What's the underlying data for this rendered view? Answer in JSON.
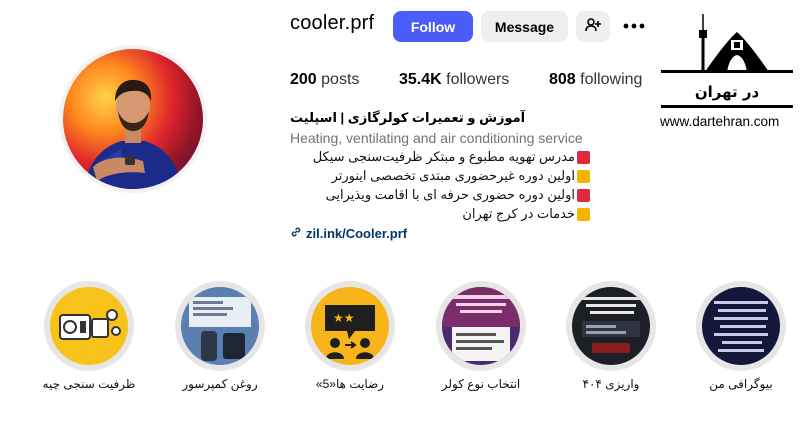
{
  "profile": {
    "username": "cooler.prf",
    "follow_label": "Follow",
    "message_label": "Message",
    "posts_count": "200",
    "posts_label": "posts",
    "followers_count": "35.4K",
    "followers_label": "followers",
    "following_count": "808",
    "following_label": "following"
  },
  "bio": {
    "name": "آموزش و تعمیرات کولرگازی | اسپلیت",
    "category": "Heating, ventilating and air conditioning service",
    "lines": [
      {
        "text": "مدرس تهویه مطبوع و مبتکر ظرفیت‌سنجی سیکل",
        "marker": "red"
      },
      {
        "text": "اولین دوره غیرحضوری مبتدی تخصصی اینورتر",
        "marker": "yellow"
      },
      {
        "text": "اولین دوره حضوری حرفه ای با اقامت ویذیرایی",
        "marker": "red"
      },
      {
        "text": "خدمات در کرج تهران",
        "marker": "yellow"
      }
    ],
    "link": "zil.ink/Cooler.prf"
  },
  "logo": {
    "text": "در تهران",
    "url": "www.dartehran.com"
  },
  "highlights": [
    {
      "label": "ظرفیت سنجی چیه"
    },
    {
      "label": "روغن کمپرسور"
    },
    {
      "label": "رضایت ها«5»"
    },
    {
      "label": "انتخاب نوع کولر"
    },
    {
      "label": "واریزی ۴۰۴"
    },
    {
      "label": "بیوگرافی من"
    }
  ],
  "colors": {
    "follow_button": "#4a5df9",
    "secondary_button": "#efefef",
    "link": "#00376b",
    "category_text": "#737373"
  },
  "icons": {
    "add_user": "add-user-icon",
    "more": "more-options-icon",
    "link": "link-icon"
  }
}
